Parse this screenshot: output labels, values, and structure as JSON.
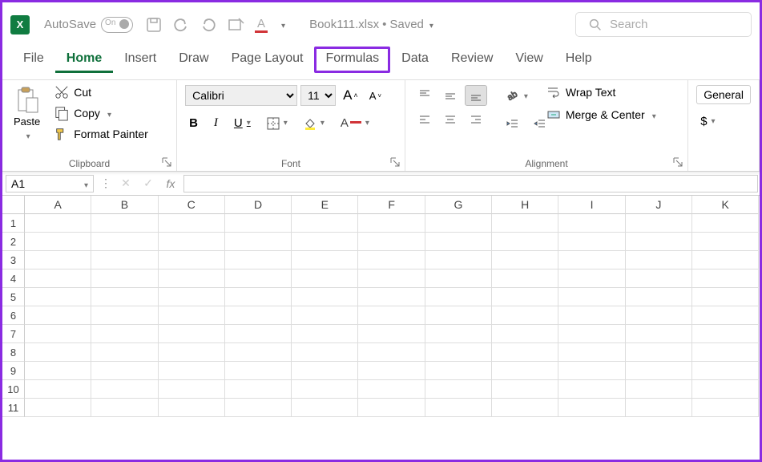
{
  "title": {
    "autosave": "AutoSave",
    "autosave_state": "On",
    "docname": "Book111.xlsx",
    "status": "Saved"
  },
  "search": {
    "placeholder": "Search"
  },
  "tabs": [
    "File",
    "Home",
    "Insert",
    "Draw",
    "Page Layout",
    "Formulas",
    "Data",
    "Review",
    "View",
    "Help"
  ],
  "active_tab": "Home",
  "highlighted_tab": "Formulas",
  "ribbon": {
    "clipboard": {
      "paste": "Paste",
      "cut": "Cut",
      "copy": "Copy",
      "format_painter": "Format Painter",
      "label": "Clipboard"
    },
    "font": {
      "name": "Calibri",
      "size": "11",
      "label": "Font"
    },
    "alignment": {
      "wrap": "Wrap Text",
      "merge": "Merge & Center",
      "label": "Alignment"
    },
    "number": {
      "format": "General"
    }
  },
  "formula_bar": {
    "cell_ref": "A1",
    "formula": ""
  },
  "columns": [
    "A",
    "B",
    "C",
    "D",
    "E",
    "F",
    "G",
    "H",
    "I",
    "J",
    "K"
  ],
  "rows": [
    1,
    2,
    3,
    4,
    5,
    6,
    7,
    8,
    9,
    10,
    11
  ]
}
